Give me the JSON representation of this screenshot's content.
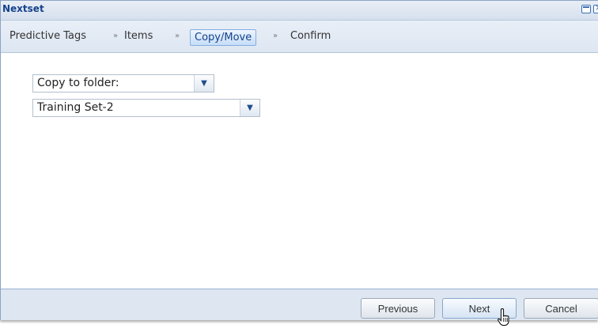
{
  "window": {
    "title": "Nextset"
  },
  "breadcrumb": {
    "steps": [
      {
        "label": "Predictive Tags"
      },
      {
        "label": "Items"
      },
      {
        "label": "Copy/Move",
        "active": true
      },
      {
        "label": "Confirm"
      }
    ],
    "separator": "»"
  },
  "form": {
    "action_select": {
      "value": "Copy to folder:"
    },
    "folder_select": {
      "value": "Training Set-2"
    }
  },
  "footer": {
    "previous_label": "Previous",
    "next_label": "Next",
    "cancel_label": "Cancel"
  },
  "colors": {
    "title": "#15428b",
    "panel": "#dfe6f0",
    "active_step_border": "#85aee0"
  }
}
